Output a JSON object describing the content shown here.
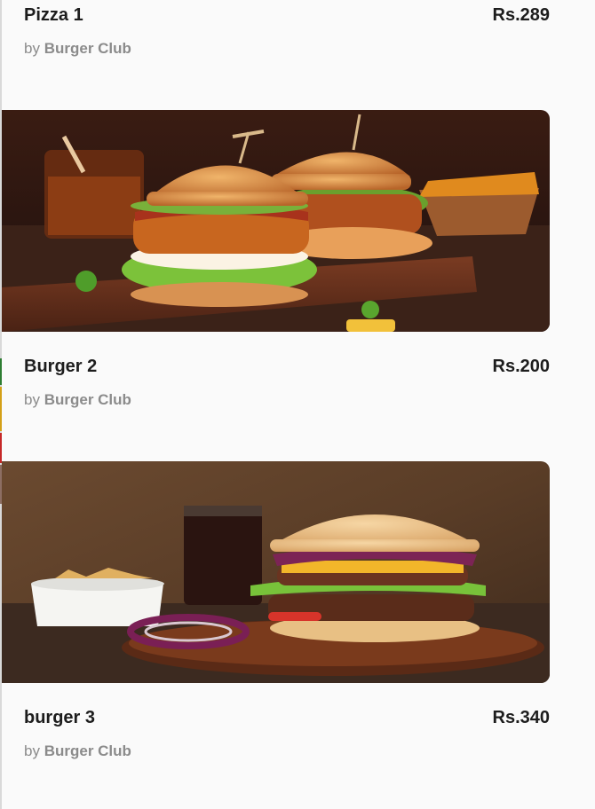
{
  "items": [
    {
      "name": "Pizza 1",
      "price": "Rs.289",
      "by_prefix": "by",
      "vendor": "Burger Club"
    },
    {
      "name": "Burger 2",
      "price": "Rs.200",
      "by_prefix": "by",
      "vendor": "Burger Club",
      "image": "double-burger-on-board-photo"
    },
    {
      "name": "burger 3",
      "price": "Rs.340",
      "by_prefix": "by",
      "vendor": "Burger Club",
      "image": "cheeseburger-with-drink-photo"
    }
  ],
  "colors": {
    "text_primary": "#1d1d1d",
    "text_muted": "#8b8b8b",
    "background": "#fafafa"
  }
}
